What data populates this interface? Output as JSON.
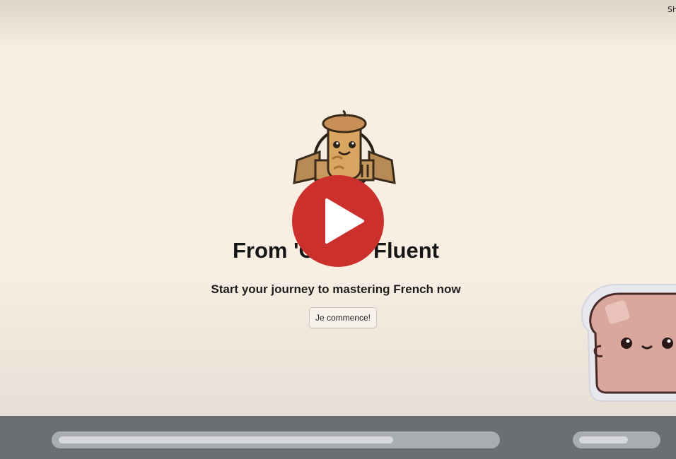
{
  "video": {
    "share_label": "Share",
    "title": "From 'Oui' to Fluent",
    "subtitle": "Start your journey to mastering French now",
    "cta_label": "Je commence!"
  },
  "player": {
    "progress": 0.77,
    "volume": 0.65
  },
  "colors": {
    "background": "#f8eee2",
    "play_button": "#cc302c",
    "controls_bar": "#6b6e73",
    "mascot": "#d9a79b"
  },
  "icons": {
    "play": "play-icon",
    "logo": "baguette-mascot-logo",
    "mascot": "toast-mascot"
  }
}
